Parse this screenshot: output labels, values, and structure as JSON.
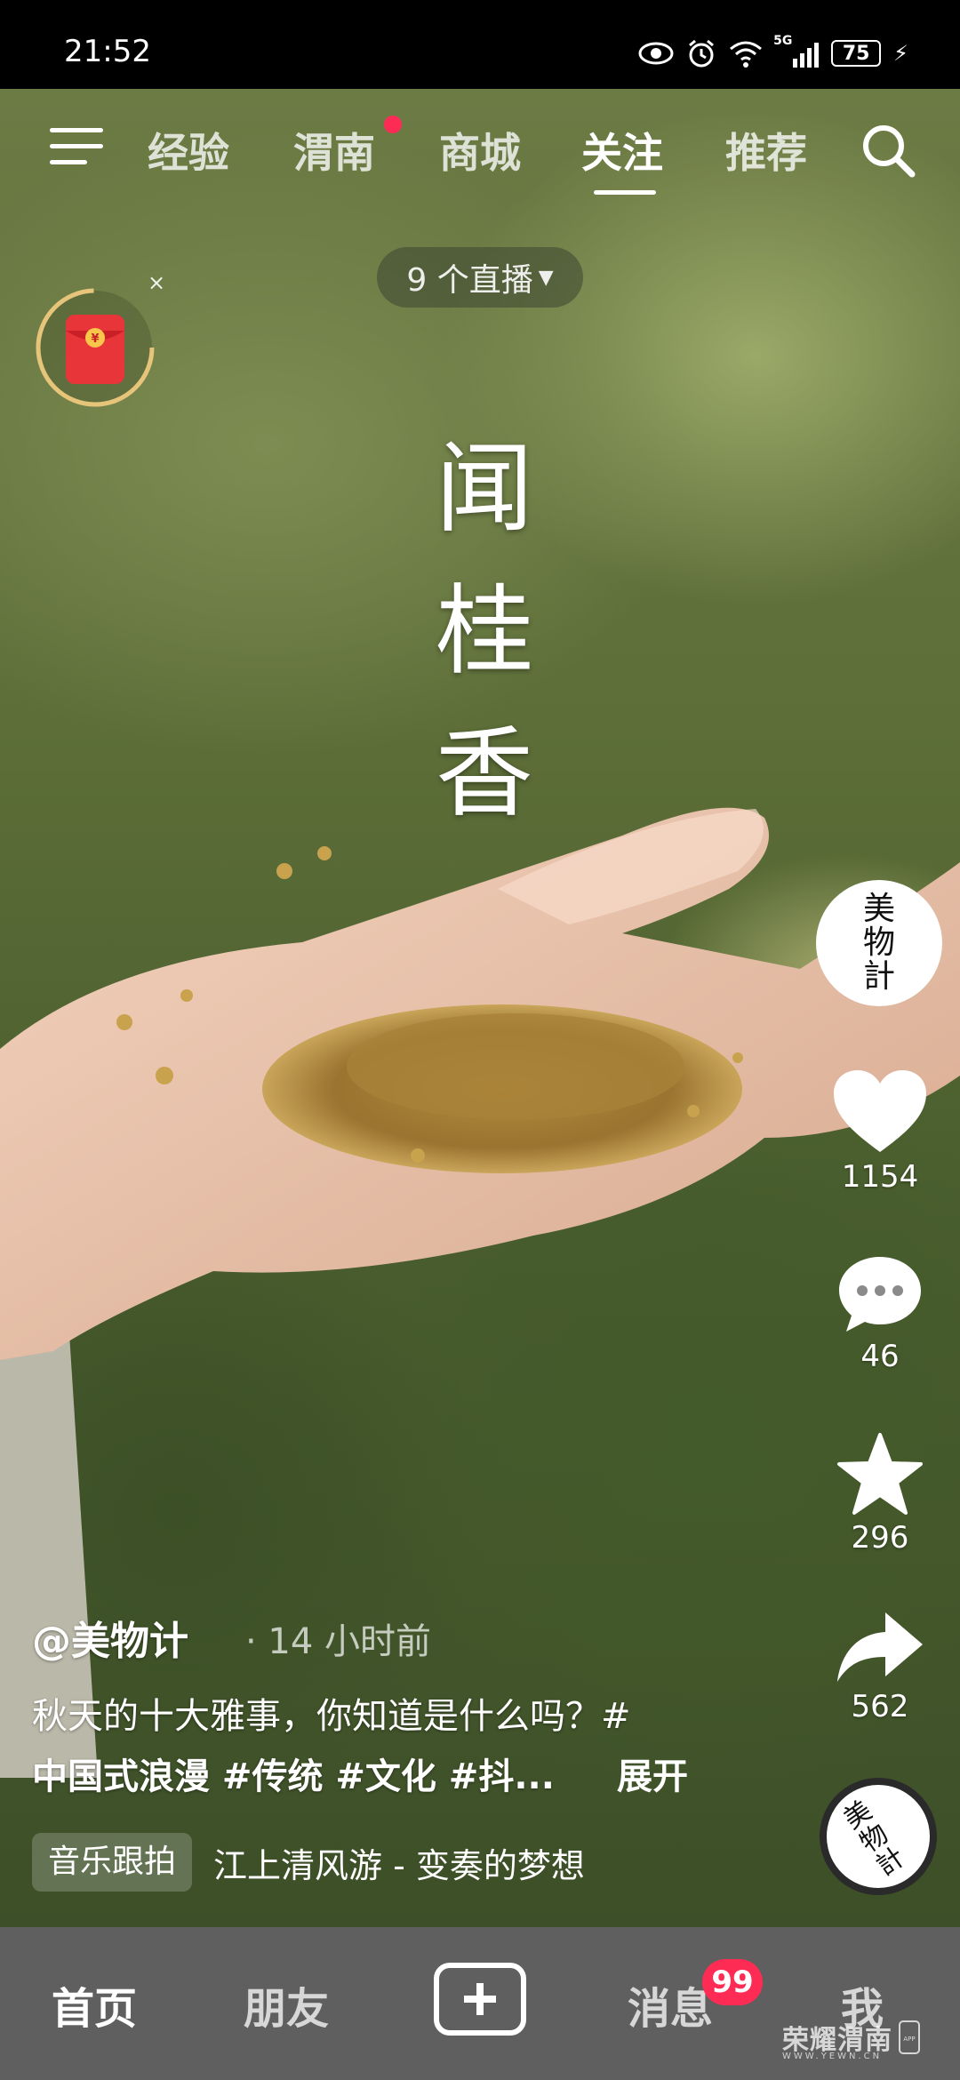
{
  "status_bar": {
    "time": "21:52",
    "network": "5G",
    "battery": "75",
    "icons": [
      "eye-icon",
      "alarm-icon",
      "wifi-icon",
      "signal-icon",
      "battery-icon",
      "charging-icon"
    ]
  },
  "top_nav": {
    "tabs": [
      {
        "label": "经验"
      },
      {
        "label": "渭南"
      },
      {
        "label": "商城"
      },
      {
        "label": "关注"
      },
      {
        "label": "推荐"
      }
    ],
    "active_tab": "关注",
    "live_pill": "9 个直播"
  },
  "video": {
    "overlay_title": [
      "闻",
      "桂",
      "香"
    ],
    "red_packet_close": "×"
  },
  "actions": {
    "avatar_text": "美物計",
    "likes": "1154",
    "comments": "46",
    "favorites": "296",
    "shares": "562",
    "music_disc_text": "美物計"
  },
  "caption": {
    "author": "@美物计",
    "time_ago": "· 14 小时前",
    "line1": "秋天的十大雅事，你知道是什么吗？#",
    "line2": "中国式浪漫 #传统 #文化 #抖...",
    "expand": "展开",
    "music_tag": "音乐跟拍",
    "music_title": "江上清风游 - 变奏的梦想"
  },
  "bottom_nav": {
    "items": [
      {
        "label": "首页"
      },
      {
        "label": "朋友"
      },
      {
        "label": "消息"
      },
      {
        "label": "我"
      }
    ],
    "active": "首页",
    "message_badge": "99"
  },
  "watermark": {
    "text": "荣耀渭南",
    "url": "WWW.YEWN.CN",
    "app": "APP"
  },
  "colors": {
    "accent_red": "#fe2c55",
    "bottom_bar": "#5f5f5f"
  }
}
